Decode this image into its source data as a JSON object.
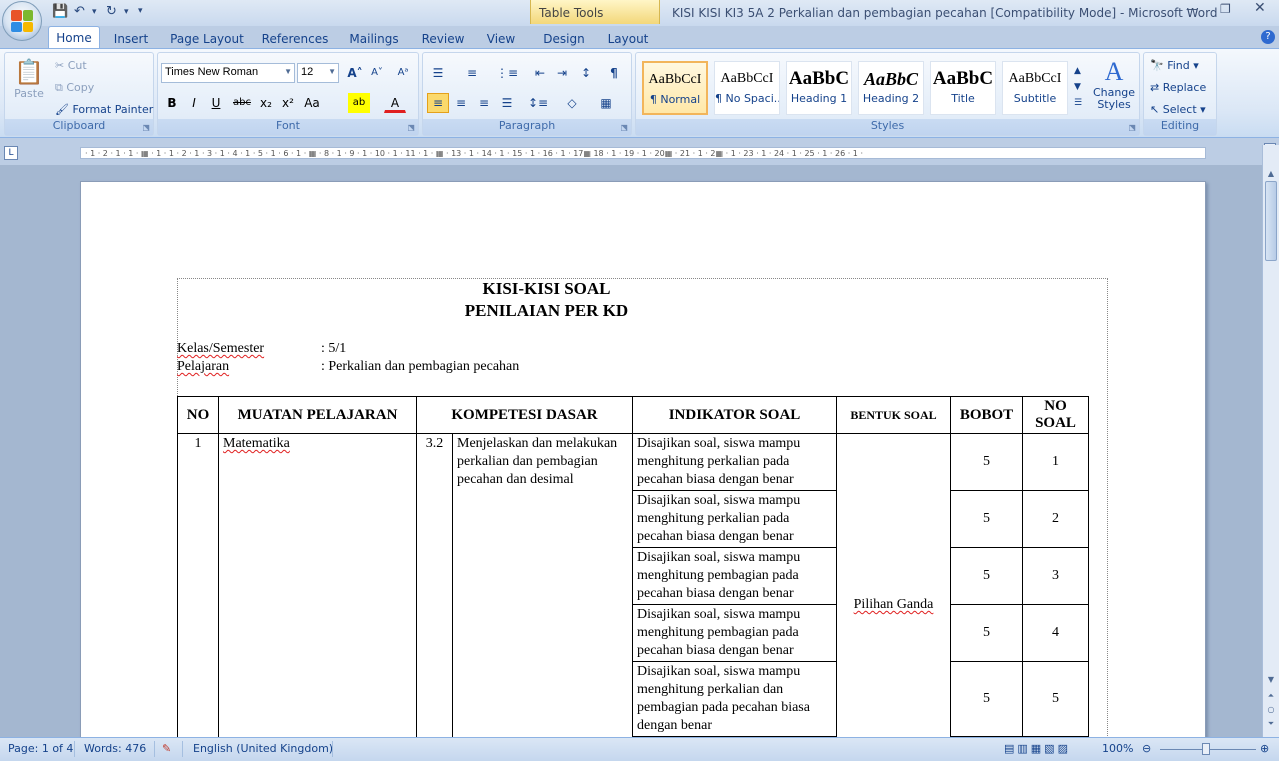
{
  "window": {
    "title": "KISI KISI KI3  5A 2 Perkalian dan pembagian pecahan [Compatibility Mode] - Microsoft Word",
    "context_tab": "Table Tools"
  },
  "tabs": [
    "Home",
    "Insert",
    "Page Layout",
    "References",
    "Mailings",
    "Review",
    "View",
    "Design",
    "Layout"
  ],
  "clipboard": {
    "paste": "Paste",
    "cut": "Cut",
    "copy": "Copy",
    "format_painter": "Format Painter",
    "label": "Clipboard"
  },
  "font": {
    "name": "Times New Roman",
    "size": "12",
    "label": "Font"
  },
  "paragraph": {
    "label": "Paragraph"
  },
  "styles": {
    "label": "Styles",
    "items": [
      {
        "sample": "AaBbCcI",
        "name": "¶ Normal"
      },
      {
        "sample": "AaBbCcI",
        "name": "¶ No Spaci..."
      },
      {
        "sample": "AaBbC",
        "name": "Heading 1"
      },
      {
        "sample": "AaBbC",
        "name": "Heading 2"
      },
      {
        "sample": "AaBbC",
        "name": "Title"
      },
      {
        "sample": "AaBbCcI",
        "name": "Subtitle"
      }
    ],
    "change_styles": "Change Styles"
  },
  "editing": {
    "find": "Find",
    "replace": "Replace",
    "select": "Select",
    "label": "Editing"
  },
  "ruler_text": "· 1 · 2 · 1 · 1 · ▦ · 1 · 1 · 2 · 1 · 3 · 1 · 4 · 1 · 5 · 1 · 6 · 1 · ▦ · 8 · 1 · 9 · 1 · 10 · 1 · 11 · 1 · ▦ · 13 · 1 · 14 · 1 · 15 · 1 · 16 · 1 · 17▦ 18 · 1 · 19 · 1 · 20▦ · 21 · 1 · 2▦ · 1 · 23 · 1 · 24 · 1 · 25 · 1 · 26 · 1 ·",
  "document": {
    "heading1": "KISI-KISI SOAL",
    "heading2": "PENILAIAN PER KD",
    "kelas_label": "Kelas/Semester",
    "kelas_value": ": 5/1",
    "pelajaran_label": "Pelajaran",
    "pelajaran_value": ": Perkalian  dan pembagian pecahan",
    "table": {
      "headers": [
        "NO",
        "MUATAN PELAJARAN",
        "KOMPETESI DASAR",
        "INDIKATOR SOAL",
        "BENTUK SOAL",
        "BOBOT",
        "NO SOAL"
      ],
      "no": "1",
      "muatan": "Matematika",
      "kd_no": "3.2",
      "kd_text": "Menjelaskan  dan melakukan perkalian  dan pembagian pecahan  dan desimal",
      "bentuk": "Pilihan Ganda",
      "rows": [
        {
          "indikator": "Disajikan soal, siswa mampu menghitung perkalian  pada pecahan biasa  dengan benar",
          "bobot": "5",
          "no_soal": "1"
        },
        {
          "indikator": "Disajikan soal, siswa mampu menghitung perkalian  pada pecahan biasa  dengan benar",
          "bobot": "5",
          "no_soal": "2"
        },
        {
          "indikator": "Disajikan soal, siswa mampu menghitung pembagian  pada pecahan biasa  dengan benar",
          "bobot": "5",
          "no_soal": "3"
        },
        {
          "indikator": "Disajikan soal, siswa mampu menghitung pembagian  pada pecahan biasa  dengan benar",
          "bobot": "5",
          "no_soal": "4"
        },
        {
          "indikator": "Disajikan soal, siswa mampu menghitung perkalian  dan pembagian pada pecahan biasa dengan benar",
          "bobot": "5",
          "no_soal": "5"
        }
      ]
    }
  },
  "status": {
    "page": "Page: 1 of 4",
    "words": "Words: 476",
    "language": "English (United Kingdom)",
    "zoom": "100%"
  }
}
